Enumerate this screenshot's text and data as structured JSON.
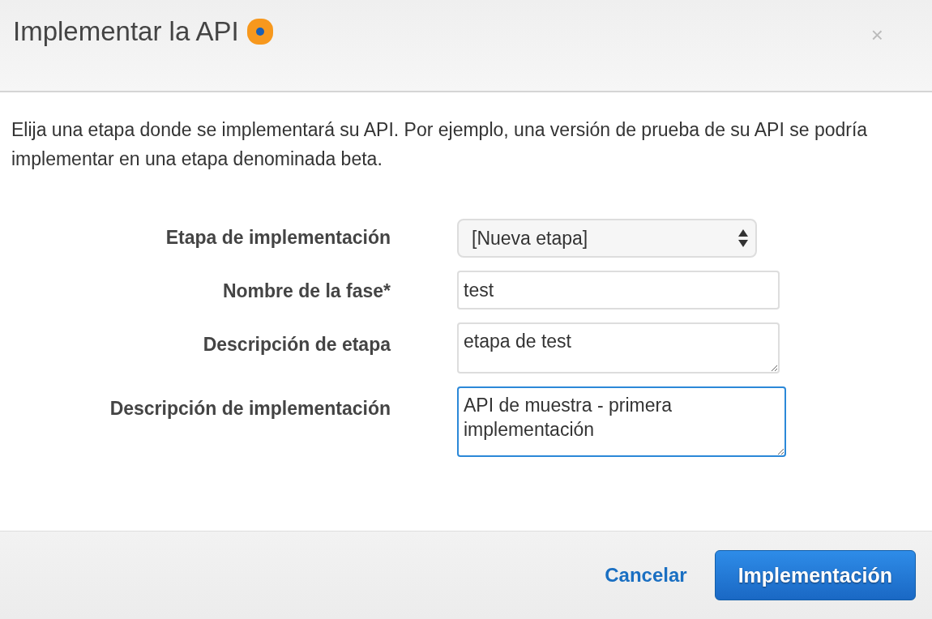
{
  "dialog": {
    "title": "Implementar la API",
    "close": "×"
  },
  "description": "Elija una etapa donde se implementará su API. Por ejemplo, una versión de prueba de su API se podría implementar en una etapa denominada beta.",
  "fields": [
    {
      "kind": "select",
      "label": "Etapa de implementación",
      "value": "[Nueva etapa]",
      "focused": false
    },
    {
      "kind": "input",
      "label": "Nombre de la fase*",
      "value": "test",
      "focused": false
    },
    {
      "kind": "textarea",
      "label": "Descripción de etapa",
      "value": "etapa de test",
      "focused": false
    },
    {
      "kind": "textarea",
      "label": "Descripción de implementación",
      "value": "API de muestra - primera implementación",
      "focused": true
    }
  ],
  "buttons": {
    "cancel": "Cancelar",
    "submit": "Implementación"
  }
}
